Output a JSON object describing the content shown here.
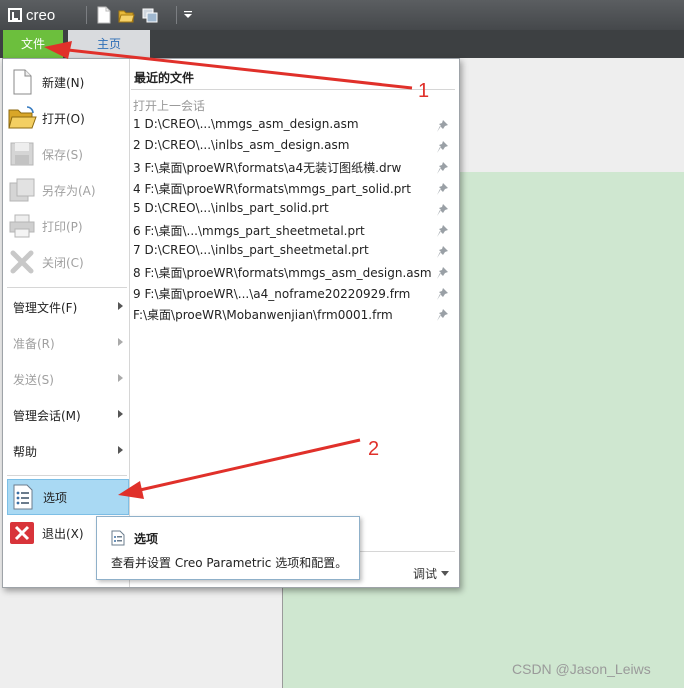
{
  "app": {
    "brand": "creo"
  },
  "ribbon": {
    "tabs": [
      {
        "label": "文件"
      },
      {
        "label": "主页"
      }
    ]
  },
  "file_menu": {
    "items": [
      {
        "label": "新建(N)",
        "icon": "new-file-icon",
        "enabled": true
      },
      {
        "label": "打开(O)",
        "icon": "open-folder-icon",
        "enabled": true
      },
      {
        "label": "保存(S)",
        "icon": "save-icon",
        "enabled": false
      },
      {
        "label": "另存为(A)",
        "icon": "save-as-icon",
        "enabled": false
      },
      {
        "label": "打印(P)",
        "icon": "print-icon",
        "enabled": false
      },
      {
        "label": "关闭(C)",
        "icon": "close-icon",
        "enabled": false
      }
    ],
    "submenus": [
      {
        "label": "管理文件(F)",
        "enabled": true
      },
      {
        "label": "准备(R)",
        "enabled": false
      },
      {
        "label": "发送(S)",
        "enabled": false
      },
      {
        "label": "管理会话(M)",
        "enabled": true
      },
      {
        "label": "帮助",
        "enabled": true
      }
    ],
    "options": {
      "label": "选项",
      "icon": "options-list-icon"
    },
    "exit": {
      "label": "退出(X)",
      "icon": "exit-icon"
    }
  },
  "recent": {
    "title": "最近的文件",
    "open_last_session": "打开上一会话",
    "files": [
      "1 D:\\CREO\\...\\mmgs_asm_design.asm",
      "2 D:\\CREO\\...\\inlbs_asm_design.asm",
      "3 F:\\桌面\\proeWR\\formats\\a4无装订图纸横.drw",
      "4 F:\\桌面\\proeWR\\formats\\mmgs_part_solid.prt",
      "5 D:\\CREO\\...\\inlbs_part_solid.prt",
      "6 F:\\桌面\\...\\mmgs_part_sheetmetal.prt",
      "7 D:\\CREO\\...\\inlbs_part_sheetmetal.prt",
      "8 F:\\桌面\\proeWR\\formats\\mmgs_asm_design.asm",
      "9 F:\\桌面\\proeWR\\...\\a4_noframe20220929.frm",
      " F:\\桌面\\proeWR\\Mobanwenjian\\frm0001.frm"
    ],
    "debug_label": "调试"
  },
  "tooltip": {
    "title": "选项",
    "description": "查看并设置 Creo Parametric 选项和配置。"
  },
  "annotations": {
    "label_1": "1",
    "label_2": "2",
    "color": "#e0302a"
  },
  "watermark": "CSDN @Jason_Leiws"
}
